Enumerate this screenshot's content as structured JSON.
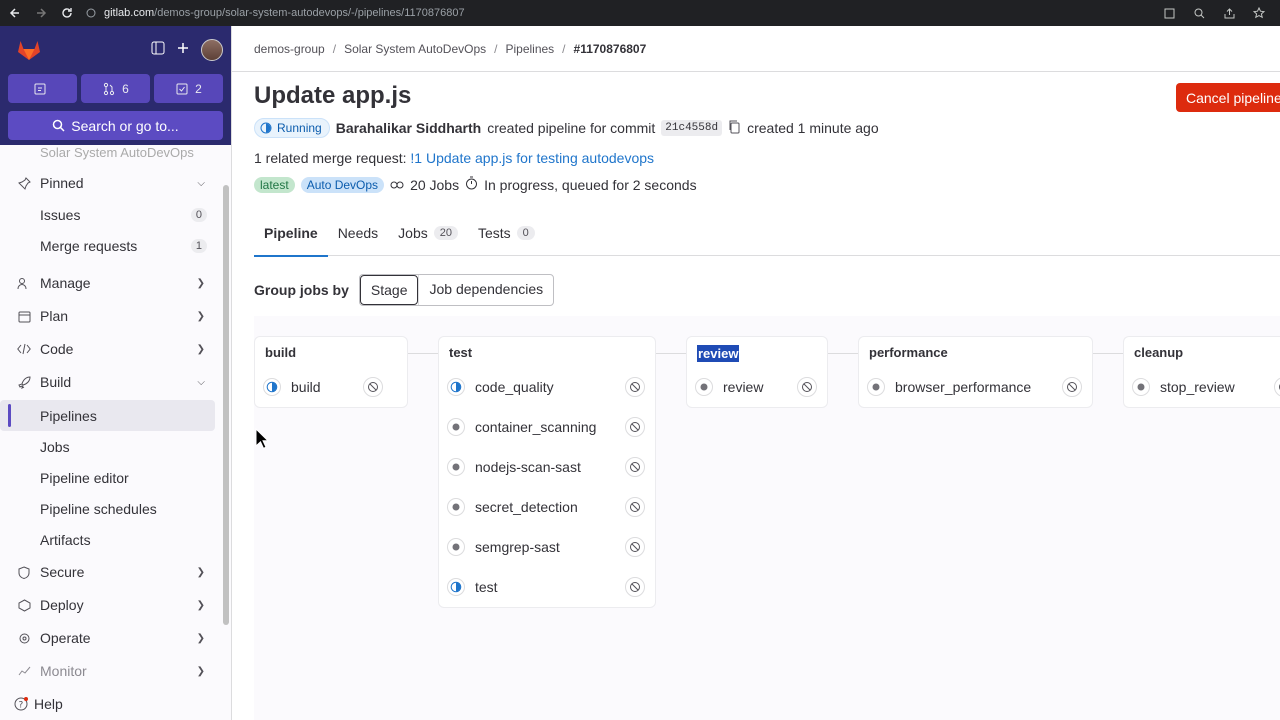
{
  "browser": {
    "url_host": "gitlab.com",
    "url_path": "/demos-group/solar-system-autodevops/-/pipelines/1170876807"
  },
  "sidebar": {
    "counters": [
      {
        "icon": "issues-icon",
        "value": ""
      },
      {
        "icon": "merge-request-icon",
        "value": "6"
      },
      {
        "icon": "todo-icon",
        "value": "2"
      }
    ],
    "search_label": "Search or go to...",
    "faded_project": "Solar System AutoDevOps",
    "pinned_label": "Pinned",
    "pinned_items": [
      {
        "label": "Issues",
        "count": "0"
      },
      {
        "label": "Merge requests",
        "count": "1"
      }
    ],
    "sections": {
      "manage": "Manage",
      "plan": "Plan",
      "code": "Code",
      "build": "Build",
      "secure": "Secure",
      "deploy": "Deploy",
      "operate": "Operate",
      "monitor": "Monitor"
    },
    "build_items": [
      "Pipelines",
      "Jobs",
      "Pipeline editor",
      "Pipeline schedules",
      "Artifacts"
    ],
    "help_label": "Help"
  },
  "breadcrumb": [
    "demos-group",
    "Solar System AutoDevOps",
    "Pipelines",
    "#1170876807"
  ],
  "pipeline": {
    "title": "Update app.js",
    "cancel_label": "Cancel pipeline",
    "status": "Running",
    "author": "Barahalikar Siddharth",
    "created_text": "created pipeline for commit",
    "commit": "21c4558d",
    "time_text": "created 1 minute ago",
    "mr_prefix": "1 related merge request:",
    "mr_link": "!1 Update app.js for testing autodevops",
    "tag_latest": "latest",
    "tag_autodevops": "Auto DevOps",
    "jobs_text": "20 Jobs",
    "queue_text": "In progress, queued for 2 seconds"
  },
  "tabs": [
    {
      "label": "Pipeline",
      "count": ""
    },
    {
      "label": "Needs",
      "count": ""
    },
    {
      "label": "Jobs",
      "count": "20"
    },
    {
      "label": "Tests",
      "count": "0"
    }
  ],
  "group_by": {
    "label": "Group jobs by",
    "options": [
      "Stage",
      "Job dependencies"
    ]
  },
  "stages": [
    {
      "name": "build",
      "jobs": [
        {
          "name": "build",
          "status": "running"
        }
      ]
    },
    {
      "name": "test",
      "jobs": [
        {
          "name": "code_quality",
          "status": "running"
        },
        {
          "name": "container_scanning",
          "status": "created"
        },
        {
          "name": "nodejs-scan-sast",
          "status": "created"
        },
        {
          "name": "secret_detection",
          "status": "created"
        },
        {
          "name": "semgrep-sast",
          "status": "created"
        },
        {
          "name": "test",
          "status": "running"
        }
      ]
    },
    {
      "name": "review",
      "jobs": [
        {
          "name": "review",
          "status": "created"
        }
      ]
    },
    {
      "name": "performance",
      "jobs": [
        {
          "name": "browser_performance",
          "status": "created"
        }
      ]
    },
    {
      "name": "cleanup",
      "jobs": [
        {
          "name": "stop_review",
          "status": "created"
        }
      ]
    }
  ],
  "colors": {
    "accent": "#1f75cb",
    "danger": "#dd2b0e",
    "sidebar_header": "#2b2a6e"
  }
}
